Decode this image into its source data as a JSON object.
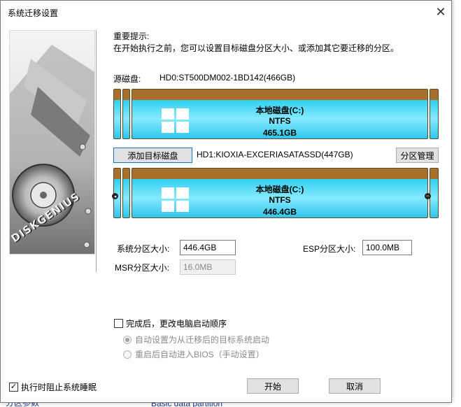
{
  "background": {
    "bottom_left_text": "分区参数",
    "bottom_mid_text": "Basic data partition"
  },
  "dialog": {
    "title": "系统迁移设置",
    "close_glyph": "✕"
  },
  "sidebar": {
    "brand": "DISKGENIUS"
  },
  "notice": {
    "title": "重要提示:",
    "text": "在开始执行之前，您可以设置目标磁盘分区大小、或添加其它要迁移的分区。"
  },
  "source": {
    "label": "源磁盘:",
    "value": "HD0:ST500DM002-1BD142(466GB)",
    "partition_name": "本地磁盘(C:)",
    "fs": "NTFS",
    "size": "465.1GB"
  },
  "target": {
    "add_button": "添加目标磁盘",
    "value": "HD1:KIOXIA-EXCERIASATASSD(447GB)",
    "manage_button": "分区管理",
    "partition_name": "本地磁盘(C:)",
    "fs": "NTFS",
    "size": "446.4GB"
  },
  "fields": {
    "system_size_label": "系统分区大小:",
    "system_size_value": "446.4GB",
    "esp_size_label": "ESP分区大小:",
    "esp_size_value": "100.0MB",
    "msr_size_label": "MSR分区大小:",
    "msr_size_value": "16.0MB"
  },
  "options": {
    "change_boot_label": "完成后，更改电脑启动顺序",
    "radio_auto": "自动设置为从迁移后的目标系统启动",
    "radio_bios": "重启后自动进入BIOS（手动设置）",
    "prevent_sleep_label": "执行时阻止系统睡眠",
    "checkmark": "✓"
  },
  "buttons": {
    "start": "开始",
    "cancel": "取消"
  }
}
